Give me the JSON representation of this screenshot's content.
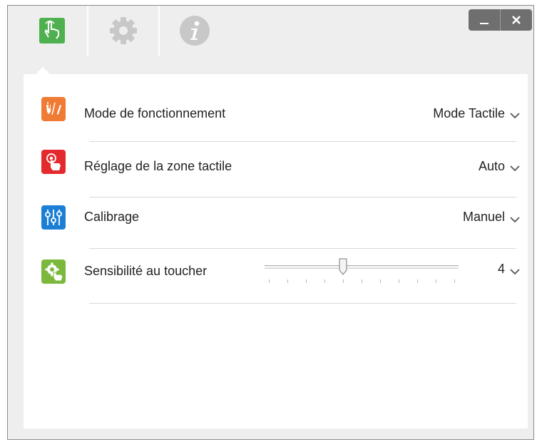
{
  "tabs": [
    {
      "name": "touch-tab-icon",
      "active": true
    },
    {
      "name": "gear-icon",
      "active": false
    },
    {
      "name": "info-icon",
      "active": false
    }
  ],
  "window_buttons": {
    "minimize": "_",
    "close": "✕"
  },
  "settings": [
    {
      "id": "mode",
      "label": "Mode de fonctionnement",
      "value": "Mode Tactile",
      "icon": "pen-touch-icon",
      "color": "#f07b34"
    },
    {
      "id": "zone",
      "label": "Réglage de la zone tactile",
      "value": "Auto",
      "icon": "touch-zone-icon",
      "color": "#e42a2e"
    },
    {
      "id": "calibration",
      "label": "Calibrage",
      "value": "Manuel",
      "icon": "sliders-icon",
      "color": "#1c7fd6"
    },
    {
      "id": "sensitivity",
      "label": "Sensibilité au toucher",
      "value": "4",
      "icon": "hand-gear-icon",
      "color": "#7cb83c"
    }
  ],
  "sensitivity_slider": {
    "min": 0,
    "max": 10,
    "value": 4
  },
  "colors": {
    "active_tab": "#4fb04f",
    "inactive_icon": "#c8c8c8"
  }
}
